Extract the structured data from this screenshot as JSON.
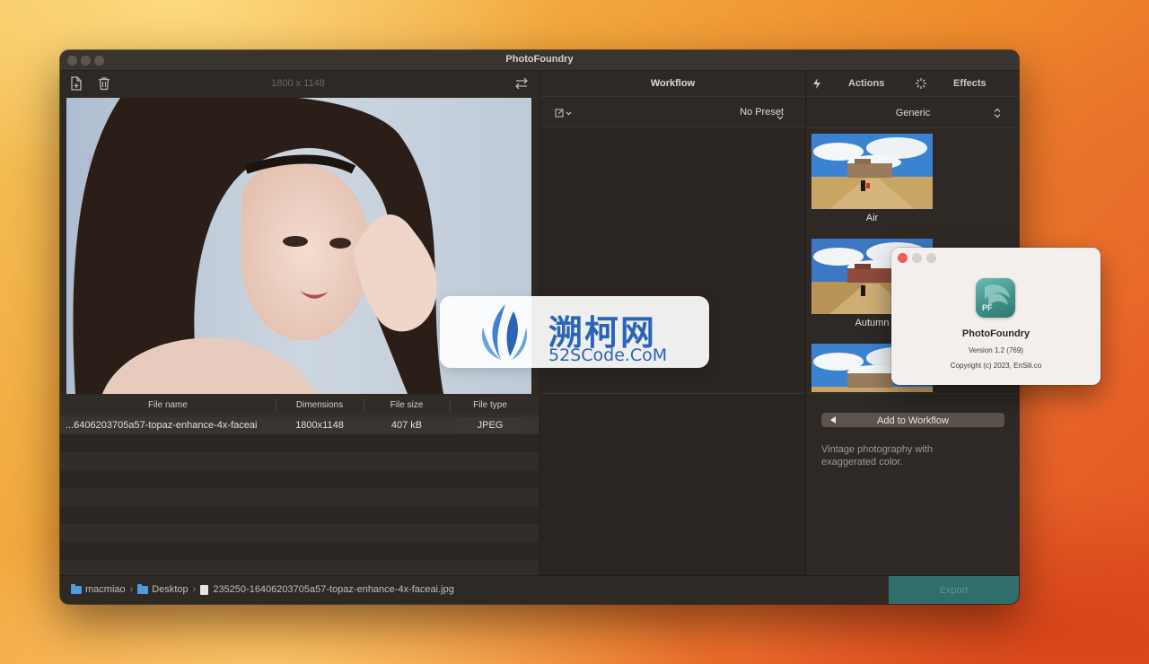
{
  "window": {
    "title": "PhotoFoundry"
  },
  "left": {
    "dimensions_label": "1800 x 1148",
    "table": {
      "headers": [
        "File name",
        "Dimensions",
        "File size",
        "File type"
      ],
      "rows": [
        {
          "name": "...6406203705a57-topaz-enhance-4x-faceai",
          "dimensions": "1800x1148",
          "size": "407 kB",
          "type": "JPEG"
        }
      ]
    }
  },
  "workflow": {
    "title": "Workflow",
    "preset_label": "No Preset"
  },
  "effects": {
    "tabs": [
      "Actions",
      "Effects"
    ],
    "category": "Generic",
    "thumbnails": [
      {
        "label": "Air"
      },
      {
        "label": "Autumn"
      }
    ],
    "add_button": "Add to Workflow",
    "description": "Vintage photography with exaggerated color."
  },
  "statusbar": {
    "path": [
      "macmiao",
      "Desktop",
      "235250-16406203705a57-topaz-enhance-4x-faceai.jpg"
    ],
    "export_label": "Export"
  },
  "about": {
    "icon_text": "PF",
    "app_name": "PhotoFoundry",
    "version": "Version 1.2 (769)",
    "copyright": "Copyright (c) 2023, EnSili.co"
  },
  "watermark": {
    "cn": "溯柯网",
    "en": "52SCode.CoM"
  },
  "colors": {
    "export_accent": "#2f6e6a",
    "folder_icon": "#4d9ce3",
    "close_button": "#ec5f57",
    "app_icon_teal": "#3f8f88",
    "watermark_blue": "#2a63b8"
  }
}
